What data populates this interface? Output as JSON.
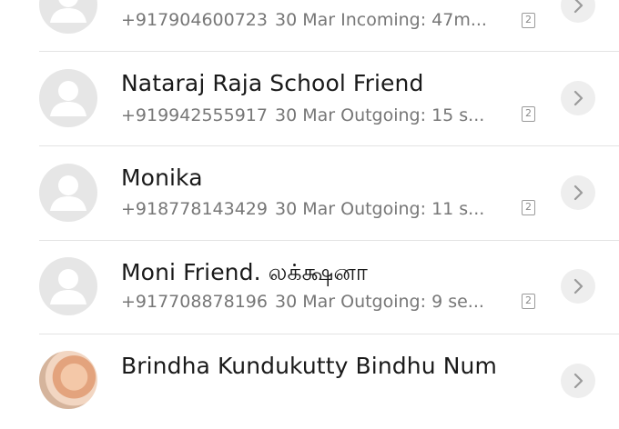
{
  "call_log": [
    {
      "name": "",
      "number": "+917904600723",
      "date": "30 Mar",
      "summary": "Incoming: 47m...",
      "sim": "2",
      "avatar": "default-contact-icon"
    },
    {
      "name": "Nataraj Raja School Friend",
      "number": "+919942555917",
      "date": "30 Mar",
      "summary": "Outgoing: 15 s...",
      "sim": "2",
      "avatar": "default-contact-icon"
    },
    {
      "name": "Monika",
      "number": "+918778143429",
      "date": "30 Mar",
      "summary": "Outgoing: 11 s...",
      "sim": "2",
      "avatar": "default-contact-icon"
    },
    {
      "name": "Moni Friend. லக்க்ஷனா",
      "number": "+917708878196",
      "date": "30 Mar",
      "summary": "Outgoing: 9 se...",
      "sim": "2",
      "avatar": "default-contact-icon"
    },
    {
      "name": "Brindha Kundukutty Bindhu Num",
      "number": "",
      "date": "",
      "summary": "",
      "sim": "",
      "avatar": "contact-photo"
    }
  ],
  "icons": {
    "details": "chevron-right-icon",
    "sim": "sim-2-icon"
  },
  "colors": {
    "background": "#ffffff",
    "name_text": "#1a1a1a",
    "detail_text": "#777777",
    "avatar_bg": "#e6e6e6",
    "divider": "#e3e3e3"
  }
}
